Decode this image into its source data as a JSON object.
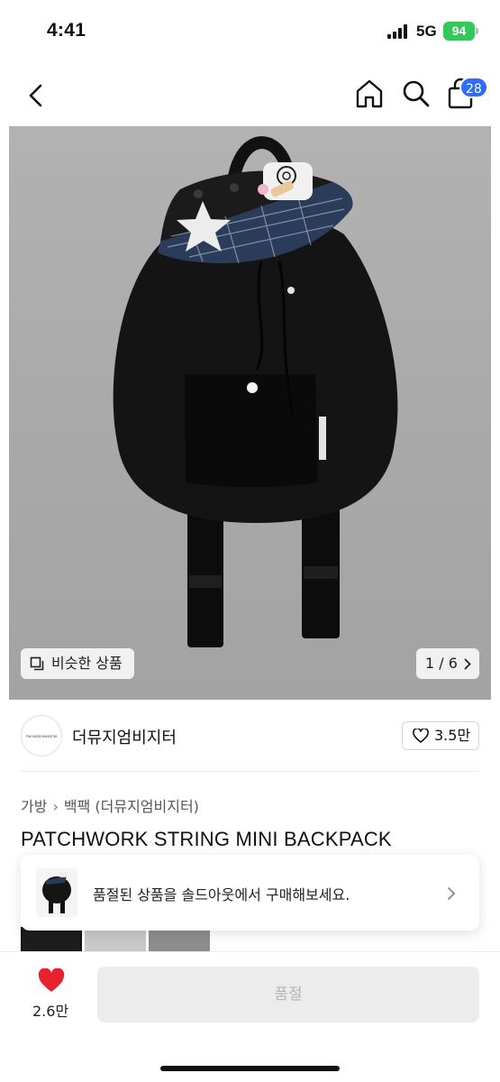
{
  "status_bar": {
    "time": "4:41",
    "network": "5G",
    "battery": "94"
  },
  "nav": {
    "back_icon": "chevron-left-icon",
    "home_icon": "home-icon",
    "search_icon": "search-icon",
    "cart_icon": "bag-icon",
    "cart_count": "28"
  },
  "gallery": {
    "similar_label": "비슷한 상품",
    "page_indicator": "1 / 6"
  },
  "brand": {
    "logo_text": "THE MUSEUMVISITOR",
    "name": "더뮤지엄비지터",
    "like_count": "3.5만"
  },
  "breadcrumb": [
    "가방",
    "백팩 (더뮤지엄비지터)"
  ],
  "product": {
    "title": "PATCHWORK STRING MINI BACKPACK"
  },
  "soldout_banner": {
    "text": "품절된 상품을 솔드아웃에서 구매해보세요."
  },
  "bottom_bar": {
    "like_count": "2.6만",
    "buy_label": "품절"
  },
  "colors": {
    "accent_blue": "#2f6bff",
    "heart_red": "#e8212e",
    "battery_green": "#34c759"
  }
}
